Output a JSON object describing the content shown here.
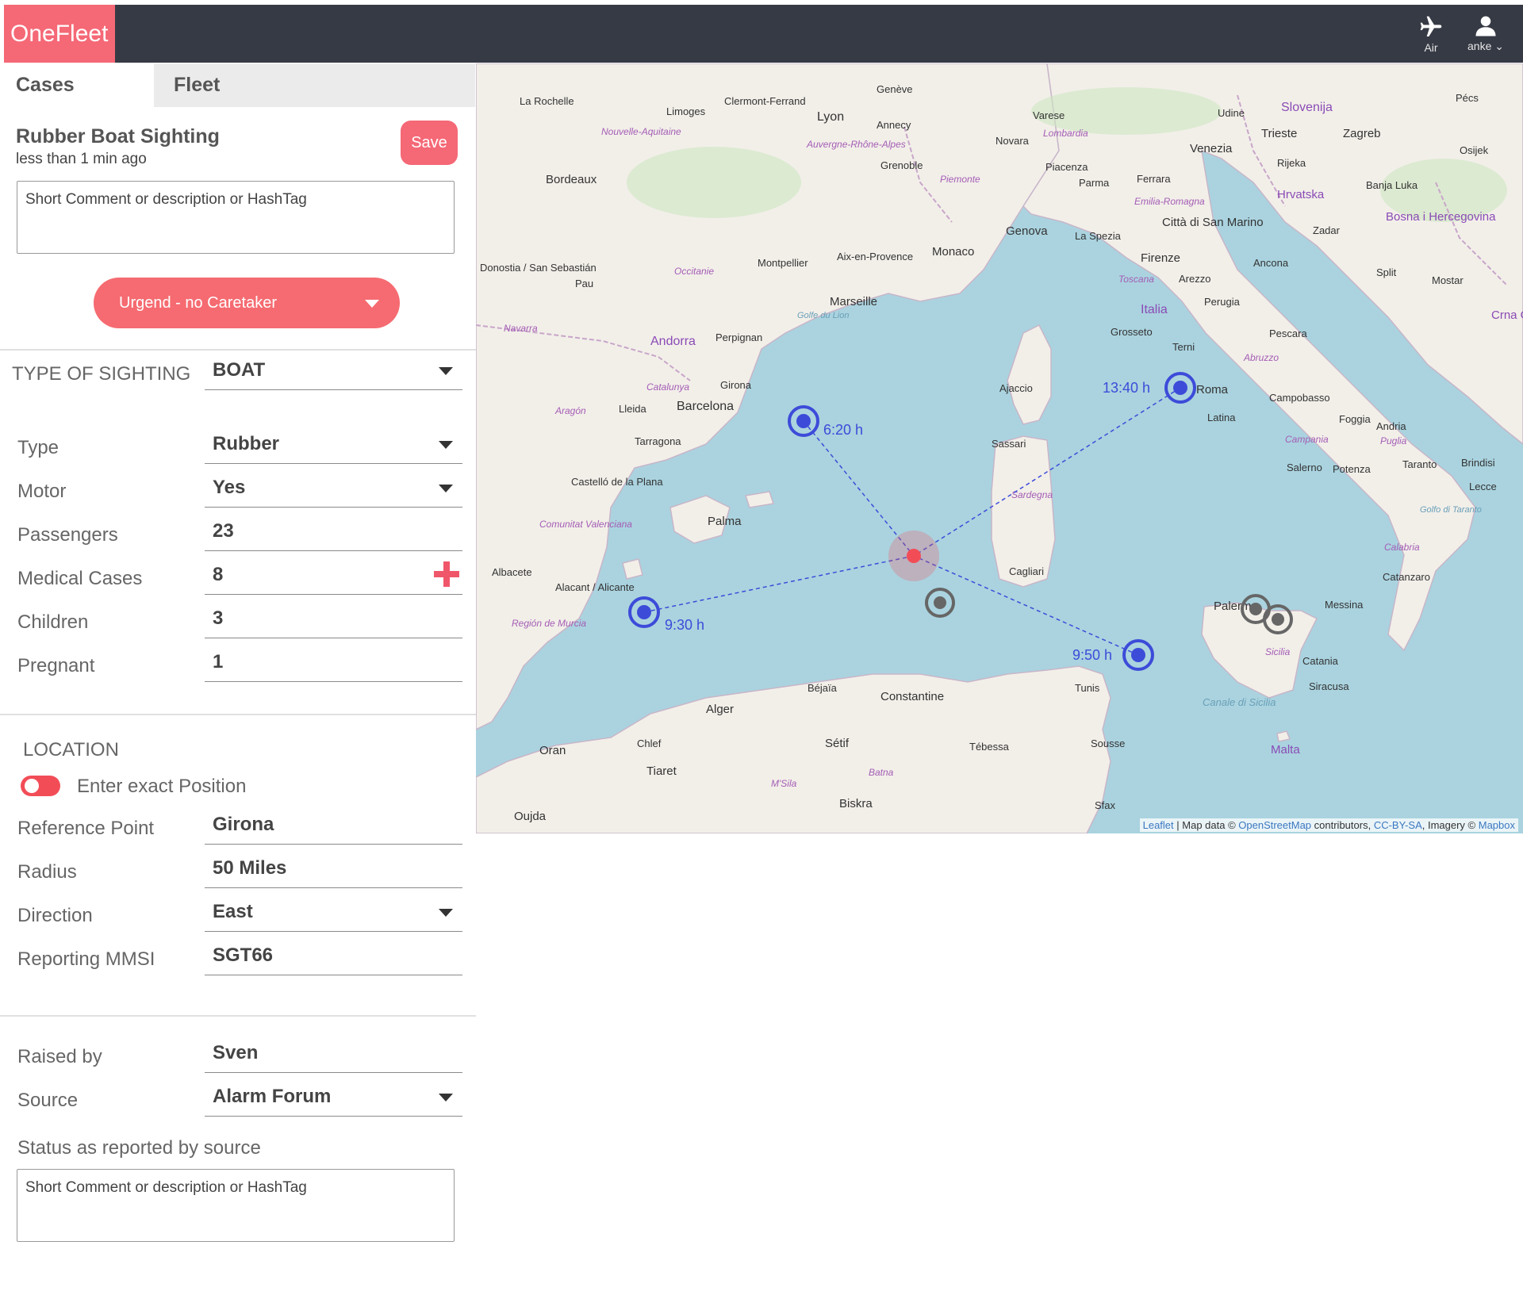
{
  "app": {
    "logo": "OneFleet"
  },
  "topbar": {
    "air_label": "Air",
    "user_label": "anke"
  },
  "tabs": {
    "cases": "Cases",
    "fleet": "Fleet"
  },
  "case": {
    "title": "Rubber Boat Sighting",
    "time": "less than 1 min ago",
    "save_label": "Save",
    "comment_placeholder": "Short Comment or description or HashTag",
    "status": "Urgend - no Caretaker"
  },
  "sighting": {
    "label": "TYPE OF SIGHTING",
    "value": "BOAT"
  },
  "details": [
    {
      "label": "Type",
      "value": "Rubber"
    },
    {
      "label": "Motor",
      "value": "Yes"
    },
    {
      "label": "Passengers",
      "value": "23"
    },
    {
      "label": "Medical Cases",
      "value": "8"
    },
    {
      "label": "Children",
      "value": "3"
    },
    {
      "label": "Pregnant",
      "value": "1"
    }
  ],
  "location": {
    "title": "LOCATION",
    "toggle_label": "Enter exact Position",
    "fields": [
      {
        "label": "Reference Point",
        "value": "Girona"
      },
      {
        "label": "Radius",
        "value": "50 Miles"
      },
      {
        "label": "Direction",
        "value": "East"
      },
      {
        "label": "Reporting MMSI",
        "value": "SGT66"
      }
    ]
  },
  "report": {
    "fields": [
      {
        "label": "Raised by",
        "value": "Sven"
      },
      {
        "label": "Source",
        "value": "Alarm Forum"
      }
    ],
    "status_label": "Status as reported by source",
    "status_placeholder": "Short Comment or description or HashTag"
  },
  "map": {
    "vessels": [
      {
        "eta": "6:20 h"
      },
      {
        "eta": "13:40 h"
      },
      {
        "eta": "9:30 h"
      },
      {
        "eta": "9:50 h"
      }
    ],
    "places": [
      "La Rochelle",
      "Limoges",
      "Clermont-Ferrand",
      "Lyon",
      "Genève",
      "Annecy",
      "Grenoble",
      "Bordeaux",
      "Nouvelle-Aquitaine",
      "Auvergne-Rhône-Alpes",
      "Montpellier",
      "Aix-en-Provence",
      "Marseille",
      "Monaco",
      "Genova",
      "Varese",
      "Novara",
      "Lombardia",
      "Piemonte",
      "Piacenza",
      "Parma",
      "Ferrara",
      "Udine",
      "Venezia",
      "Trieste",
      "Slovenija",
      "Zagreb",
      "Hrvatska",
      "Rijeka",
      "Pécs",
      "Osijek",
      "Banja Luka",
      "Bosna i Hercegovina",
      "Zadar",
      "Split",
      "Mostar",
      "Crna G",
      "Emilia-Romagna",
      "La Spezia",
      "Città di San Marino",
      "Firenze",
      "Arezzo",
      "Toscana",
      "Ancona",
      "Italia",
      "Perugia",
      "Grosseto",
      "Terni",
      "Pescara",
      "Abruzzo",
      "Roma",
      "Latina",
      "Campobasso",
      "Foggia",
      "Andria",
      "Puglia",
      "Campania",
      "Salerno",
      "Potenza",
      "Taranto",
      "Brindisi",
      "Lecce",
      "Calabria",
      "Catanzaro",
      "Messina",
      "Palermo",
      "Sicilia",
      "Catania",
      "Siracusa",
      "Malta",
      "Donostia / San Sebastián",
      "Pau",
      "Occitanie",
      "Navarra",
      "Andorra",
      "Perpignan",
      "Catalunya",
      "Girona",
      "Barcelona",
      "Lleida",
      "Aragón",
      "Tarragona",
      "Castelló de la Plana",
      "Comunitat Valenciana",
      "Palma",
      "Albacete",
      "Alacant / Alicante",
      "Región de Murcia",
      "Ajaccio",
      "Sassari",
      "Sardegna",
      "Cagliari",
      "Béjaïa",
      "Constantine",
      "Alger",
      "Oran",
      "Chlef",
      "Tiaret",
      "Sétif",
      "Batna",
      "Biskra",
      "Tébessa",
      "M'Sila",
      "Oujda",
      "Golfe du Lion",
      "Canale di Sicilia",
      "Golfo di Taranto",
      "Tunis",
      "Sousse",
      "Sfax"
    ],
    "attribution": {
      "leaflet": "Leaflet",
      "text1": " | Map data © ",
      "osm": "OpenStreetMap",
      "text2": " contributors, ",
      "license": "CC-BY-SA",
      "text3": ", Imagery © ",
      "mapbox": "Mapbox"
    }
  },
  "colors": {
    "accent": "#f56876",
    "topbar": "#363a45",
    "sea": "#aad3df",
    "land": "#f2efe9",
    "vessel": "#3d4bd9",
    "case": "#f24d57"
  }
}
